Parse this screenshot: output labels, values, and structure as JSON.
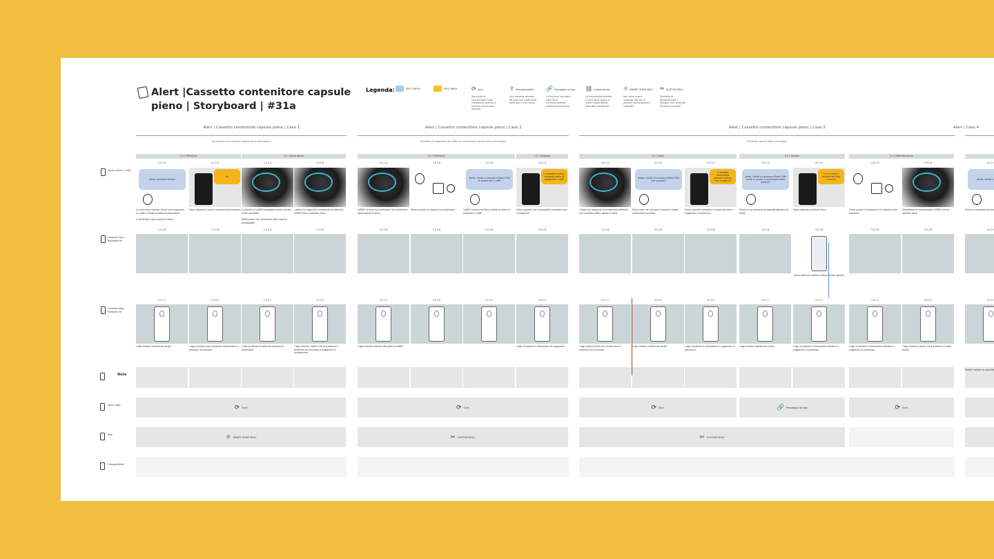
{
  "header": {
    "title": "Alert |Cassetto contenitore capsule pieno | Storyboard | #31a"
  },
  "legend": {
    "label": "Legenda:",
    "items": [
      {
        "name": "Voce utente",
        "color": "#A9CCE3",
        "desc": ""
      },
      {
        "name": "Voce Alexa",
        "color": "#F5C518",
        "desc": ""
      },
      {
        "name": "Sync",
        "icon": "sync-icon",
        "desc": "Necessità di sincronizzare l'app companion quando le funzioni vocali sono lanciate"
      },
      {
        "name": "Interoperabilità",
        "icon": "share-icon",
        "desc": "Una funzione lanciata da voce può continuare dalla App e vice versa"
      },
      {
        "name": "Passaggio ad app",
        "icon": "link-icon",
        "desc": "La funzione lanciata a voce deve necessariamente continuare sulla App"
      },
      {
        "name": "Indipendente",
        "icon": "broken-link-icon",
        "desc": "La funzionalità attivata a voce verrà svolta in modo indipendente dalla App companion"
      },
      {
        "name": "SMART HOME SKILL",
        "icon": "bulb-icon",
        "desc": "Non deve essere invocata. Ma non si possono personalizzare i dialoghi"
      },
      {
        "name": "CUSTOM SKILL",
        "icon": "tools-icon",
        "desc": "Permette di personalizzare i dialoghi, ma necessita di essere invocata"
      }
    ]
  },
  "rows": [
    {
      "label": "Alexa (voice + led)"
    },
    {
      "label": "Lavazza App | Background"
    },
    {
      "label": "Lavazza App | Foreground"
    },
    {
      "label": "Note"
    },
    {
      "label": "Voce / App"
    },
    {
      "label": "Skill"
    },
    {
      "label": "Compatibilità"
    }
  ],
  "cases": [
    {
      "title": "Alert | Cassetto contenitore capsule pieno | Caso 1",
      "subtitle": "Accensione con cassetto capsule pieno (Anticipato)",
      "sections": [
        {
          "label": "1.1 | Richiesta",
          "span": 2
        },
        {
          "label": "1.2 | Accensione",
          "span": 2
        }
      ],
      "frames": [
        {
          "id": "1.1.1",
          "kind": "bubble-user",
          "bubble": "Alexa, accendi Lavazza",
          "caption": "La macchina è spenta. Elena vuole preparare un caffè e chiede ad Alexa di accenderla.",
          "caption2": "Il contenitore delle capsule è pieno.",
          "fg_caption": "L'app mostra l'interfaccia vocale"
        },
        {
          "id": "1.1.2",
          "kind": "machine-alexa",
          "bubble": "Ok",
          "caption": "Alexa risponde e avvia il processo di accensione",
          "fg_caption": "L'app riproduce (alla richiesta) informazioni al processo 'accensione'"
        },
        {
          "id": "1.2.1",
          "kind": "machine-ring",
          "caption": "Il pulsante di LAMM lampeggia mentre l'acqua viene riscaldata",
          "caption2": "Notificazione del contenitore delle capsule lampeggiate",
          "fg_caption": "L'app visualizza lo stato del processo di accensione"
        },
        {
          "id": "1.2.2",
          "kind": "machine-ring",
          "caption": "L'acqua ha raggiunto la temperatura ottimale. LAMM invia un segnale visivo",
          "fg_caption": "L'app informa l'utente che l'accensione è avvenuta con successo e suggerisce lo svuotamento"
        }
      ],
      "voice_app": [
        {
          "label": "Sync",
          "icon": "sync-icon",
          "span": 4
        }
      ],
      "skill": [
        {
          "label": "SMART HOME SKILL",
          "icon": "bulb-icon",
          "span": 4
        }
      ]
    },
    {
      "title": "Alert | Cassetto contenitore capsule pieno | Caso 2",
      "subtitle": "Richiesta di erogazione del caffè con contenitore capsule pieno (Anticipato)",
      "sections": [
        {
          "label": "2.1 | Richiesta",
          "span": 3
        },
        {
          "label": "2.2 | Risposta",
          "span": 1
        }
      ],
      "frames": [
        {
          "id": "2.1.1",
          "kind": "machine-ring",
          "caption": "LAMM è accesa ma l'indicatore del contenitore delle capsule è pieno",
          "fg_caption": "L'app informa l'utente sullo stato di LAMM"
        },
        {
          "id": "2.1.2",
          "kind": "drawing",
          "caption": "Elena inserisce la capsula nel contenitore",
          "fg_caption": ""
        },
        {
          "id": "2.1.3",
          "kind": "bubble-user",
          "bubble": "Alexa, chiedi a Lavazza a Mostri Mio di preparare il caffè",
          "caption": "LAMM è accesa ed Elena chiede ad Alexa di preparare il caffè",
          "fg_caption": ""
        },
        {
          "id": "2.2.1",
          "kind": "machine-alexa",
          "bubble": "Il cassetto è pieno, svuotalo prima di preparare il caffè",
          "caption": "Alexa risponde con una possibile procedura per l'erogazione",
          "fg_caption": "L'app visualizza le informazioni di erogazione"
        }
      ],
      "voice_app": [
        {
          "label": "Sync",
          "icon": "sync-icon",
          "span": 4
        }
      ],
      "skill": [
        {
          "label": "CUSTOM SKILL",
          "icon": "tools-icon",
          "span": 4
        }
      ]
    },
    {
      "title": "Alert | Cassetto contenitore capsule pieno | Caso 3",
      "subtitle": "Richiesta tutorial (Alert Anticipato)",
      "sections": [
        {
          "label": "3.1 | Alert",
          "span": 3
        },
        {
          "label": "3.2 | Tutorial",
          "span": 2
        },
        {
          "label": "3.3 | Manutenzione",
          "span": 2
        }
      ],
      "frames": [
        {
          "id": "3.1.1",
          "kind": "machine-ring",
          "caption": "L'acqua ha raggiunto la temperatura ottimale ma il cassetto delle capsule è pieno",
          "fg_caption": "L'app informa Elena che l'accensione è avvenuta con successo"
        },
        {
          "id": "3.1.2",
          "kind": "bubble-user",
          "bubble": "Alexa, chiedi a Lavazza a Mostri Mio che succede?",
          "caption": "Elena vede che una spia è accesa e chiede informazioni ad Alexa",
          "fg_caption": "L'app mostra l'interfaccia vocale"
        },
        {
          "id": "3.1.3",
          "kind": "machine-alexa",
          "bubble": "Il cassetto contenitore capsule è pieno, vuoi il tutorial?",
          "caption": "Alexa risponde indicando il motivo dell'alert e suggerisce la procedura",
          "fg_caption": "L'app visualizza le informazioni e suggerisce la procedura"
        },
        {
          "id": "3.2.1",
          "kind": "bubble-user",
          "bubble": "Alexa, chiedi a Lavazza a Mostri Mio come si svuota il contenitore delle capsule?",
          "caption": "Elena fa una domanda di approfondimento ad Alexa",
          "fg_caption": "L'app mostra l'interfaccia vocale"
        },
        {
          "id": "3.2.2",
          "kind": "machine-alexa",
          "bubble": "Ti ho inviato il tutorial nell'app Lavazza",
          "caption": "Alexa risponde guidando Elena",
          "bg_caption": "Alexa invia una notifica relativa al tipo capsule",
          "fg_caption": "L'app visualizza le informazioni sull'alert e suggerisce la procedura"
        },
        {
          "id": "3.3.1",
          "kind": "drawing",
          "caption": "Elena svuota il contenitore e lo rimonta nella macchina",
          "fg_caption": "L'app visualizza le informazioni sull'alert e suggerisce la procedura"
        },
        {
          "id": "3.3.2",
          "kind": "machine-ring",
          "caption": "Completata la manutenzione LAMM invia un segnale visivo",
          "fg_caption": "L'app informa l'utente che il problema è stato risolto"
        }
      ],
      "voice_app": [
        {
          "label": "Sync",
          "icon": "sync-icon",
          "span": 3
        },
        {
          "label": "Passaggio ad app",
          "icon": "link-icon",
          "span": 2
        },
        {
          "label": "Sync",
          "icon": "sync-icon",
          "span": 2
        }
      ],
      "skill": [
        {
          "label": "CUSTOM SKILL",
          "icon": "tools-icon",
          "span": 5
        },
        {
          "label": "",
          "span": 2,
          "light": true
        }
      ]
    },
    {
      "title": "Alert | Caso 4",
      "subtitle": "",
      "sections": [
        {
          "label": "",
          "span": 1
        }
      ],
      "frames": [
        {
          "id": "4.1.1",
          "kind": "bubble-user",
          "bubble": "Alexa, chiedi a Lavazza...",
          "caption": "Elena ha cancellato per problemi...",
          "fg_caption": ""
        }
      ],
      "voice_app": [
        {
          "label": "",
          "span": 1
        }
      ],
      "skill": [
        {
          "label": "",
          "span": 1
        }
      ],
      "note": "Poiché l'utente ha cancellato l'app la notifica..."
    }
  ]
}
